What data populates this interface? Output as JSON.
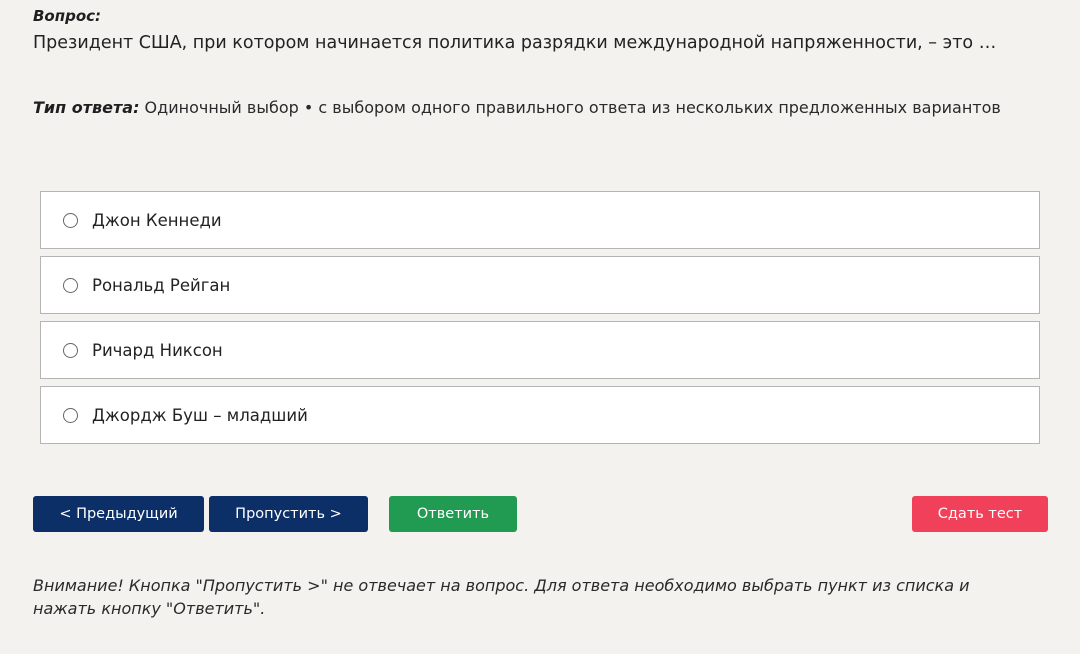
{
  "question": {
    "caption": "Вопрос:",
    "text": "Президент США, при котором начинается политика разрядки международной напряженности, – это …"
  },
  "answer_type": {
    "label": "Тип ответа:",
    "value": " Одиночный выбор • с выбором одного правильного ответа из нескольких предложенных вариантов"
  },
  "options": [
    {
      "label": "Джон Кеннеди",
      "selected": false
    },
    {
      "label": "Рональд Рейган",
      "selected": false
    },
    {
      "label": "Ричард Никсон",
      "selected": false
    },
    {
      "label": "Джордж Буш – младший",
      "selected": false
    }
  ],
  "buttons": {
    "prev": "< Предыдущий",
    "skip": "Пропустить >",
    "answer": "Ответить",
    "submit": "Сдать тест"
  },
  "colors": {
    "nav_button": "#0b2f66",
    "answer_button": "#219a52",
    "submit_button": "#f0405a",
    "background": "#f3f2ef"
  },
  "notice": "Внимание! Кнопка \"Пропустить >\" не отвечает на вопрос. Для ответа необходимо выбрать пункт из списка и нажать кнопку \"Ответить\"."
}
